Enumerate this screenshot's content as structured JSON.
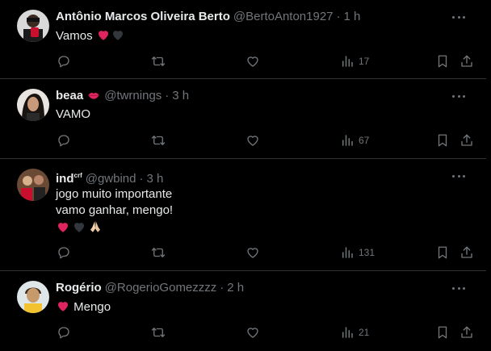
{
  "colors": {
    "background": "#000000",
    "text": "#e7e9ea",
    "muted": "#71767b",
    "divider": "#2f3336",
    "heart_red": "#e0245e"
  },
  "tweets": [
    {
      "display_name": "Antônio Marcos Oliveira Berto",
      "handle": "@BertoAnton1927",
      "separator": "·",
      "time": "1 h",
      "text_lines": [
        "Vamos"
      ],
      "text_emojis": [
        "red-heart",
        "black-heart"
      ],
      "views": "17",
      "avatar_icon": "avatar-person-icon"
    },
    {
      "display_name": "beaa",
      "name_emoji": "kiss-lips",
      "handle": "@twrnings",
      "separator": "·",
      "time": "3 h",
      "text_lines": [
        "VAMO"
      ],
      "views": "67",
      "avatar_icon": "avatar-person-icon"
    },
    {
      "display_name": "ind",
      "name_superscript": "crf",
      "handle": "@gwbind",
      "separator": "·",
      "time": "3 h",
      "text_lines": [
        "jogo muito importante",
        "vamo ganhar, mengo!"
      ],
      "text_emojis": [
        "red-heart",
        "black-heart",
        "folded-hands"
      ],
      "views": "131",
      "avatar_icon": "avatar-group-icon"
    },
    {
      "display_name": "Rogério",
      "handle": "@RogerioGomezzzz",
      "separator": "·",
      "time": "2 h",
      "text_lines": [
        "Mengo"
      ],
      "text_emojis": [
        "red-heart"
      ],
      "views": "21",
      "avatar_icon": "avatar-person-icon"
    }
  ]
}
